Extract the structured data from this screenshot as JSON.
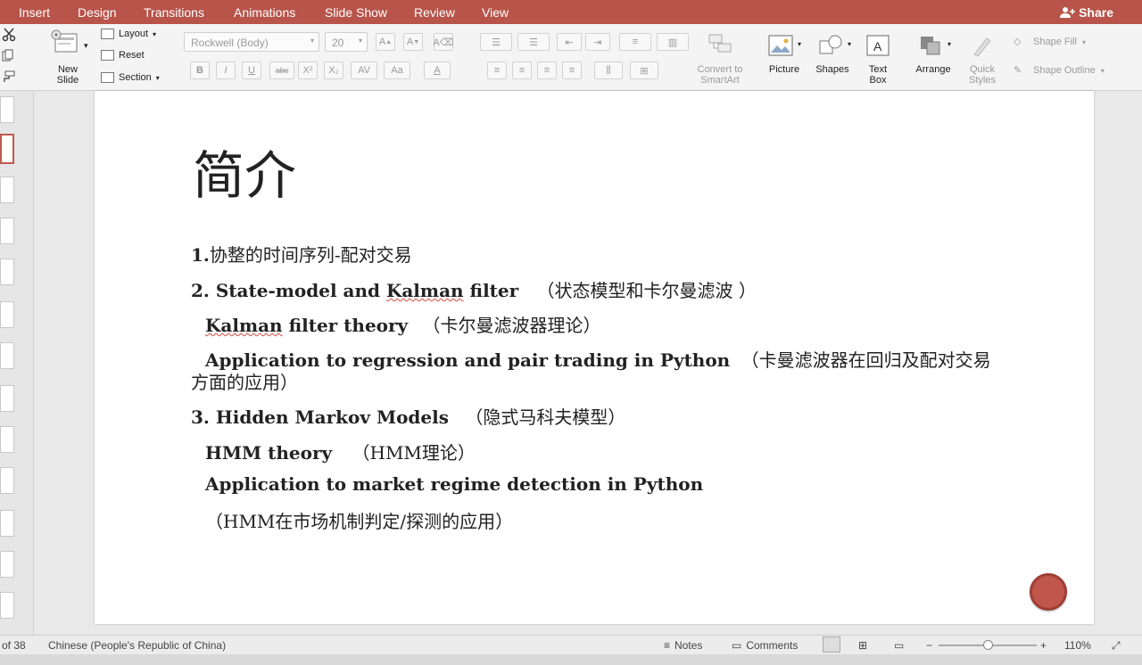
{
  "tabs": [
    "Insert",
    "Design",
    "Transitions",
    "Animations",
    "Slide Show",
    "Review",
    "View"
  ],
  "share_label": "Share",
  "ribbon": {
    "new_slide": "New\nSlide",
    "layout": "Layout",
    "reset": "Reset",
    "section": "Section",
    "font_name": "Rockwell (Body)",
    "font_size": "20",
    "format_buttons": [
      "B",
      "I",
      "U",
      "abc",
      "X²",
      "X₂",
      "AV",
      "Aa",
      "A"
    ],
    "convert_smartart": "Convert to\nSmartArt",
    "picture": "Picture",
    "shapes": "Shapes",
    "text_box": "Text\nBox",
    "arrange": "Arrange",
    "quick_styles": "Quick\nStyles",
    "shape_fill": "Shape Fill",
    "shape_outline": "Shape Outline"
  },
  "slide": {
    "title": "简介",
    "lines": [
      {
        "latin": "1.",
        "cjk": "协整的时间序列-配对交易"
      },
      {
        "latin": "2. State-model and ",
        "latin_sq": "Kalman",
        "latin2": " filter",
        "cjk": "（状态模型和卡尔曼滤波 ）"
      },
      {
        "latin_sq": "Kalman",
        "latin2": " filter theory",
        "cjk": "（卡尔曼滤波器理论）"
      },
      {
        "latin": "Application to regression and pair trading in Python",
        "cjk": "（卡曼滤波器在回归及配对交易"
      },
      {
        "cjk": "方面的应用）"
      },
      {
        "latin": "3. Hidden Markov Models",
        "cjk": "（隐式马科夫模型）"
      },
      {
        "latin": "HMM theory",
        "cjk": "（HMM理论）"
      },
      {
        "latin": "Application to market regime detection in Python"
      },
      {
        "cjk": "（HMM在市场机制判定/探测的应用）"
      }
    ]
  },
  "status": {
    "slide_count": "of 38",
    "language": "Chinese (People's Republic of China)",
    "notes": "Notes",
    "comments": "Comments",
    "zoom_minus": "−",
    "zoom_plus": "+",
    "zoom": "110%"
  },
  "colors": {
    "tabbar": "#b8544a",
    "accent": "#c25a4f"
  }
}
